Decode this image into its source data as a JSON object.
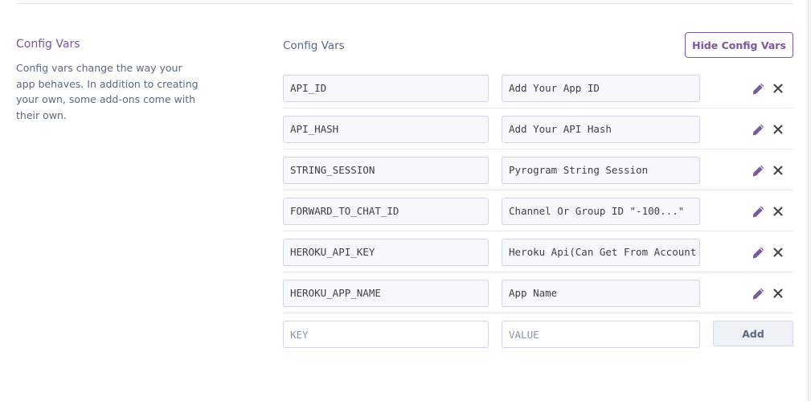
{
  "section": {
    "title": "Config Vars",
    "description": "Config vars change the way your app behaves. In addition to creating your own, some add-ons come with their own."
  },
  "panel": {
    "title": "Config Vars",
    "hide_button_label": "Hide Config Vars"
  },
  "config_vars": [
    {
      "key": "API_ID",
      "value": "Add Your App ID"
    },
    {
      "key": "API_HASH",
      "value": "Add Your API Hash"
    },
    {
      "key": "STRING_SESSION",
      "value": "Pyrogram String Session"
    },
    {
      "key": "FORWARD_TO_CHAT_ID",
      "value": "Channel Or Group ID \"-100...\""
    },
    {
      "key": "HEROKU_API_KEY",
      "value": "Heroku Api(Can Get From Account"
    },
    {
      "key": "HEROKU_APP_NAME",
      "value": "App Name"
    }
  ],
  "new_var": {
    "key_placeholder": "KEY",
    "value_placeholder": "VALUE",
    "add_label": "Add"
  },
  "icons": {
    "edit": "pencil-icon",
    "delete": "close-icon"
  },
  "colors": {
    "accent": "#79589f",
    "text_muted": "#596981",
    "delete_icon": "#3f3f44"
  }
}
